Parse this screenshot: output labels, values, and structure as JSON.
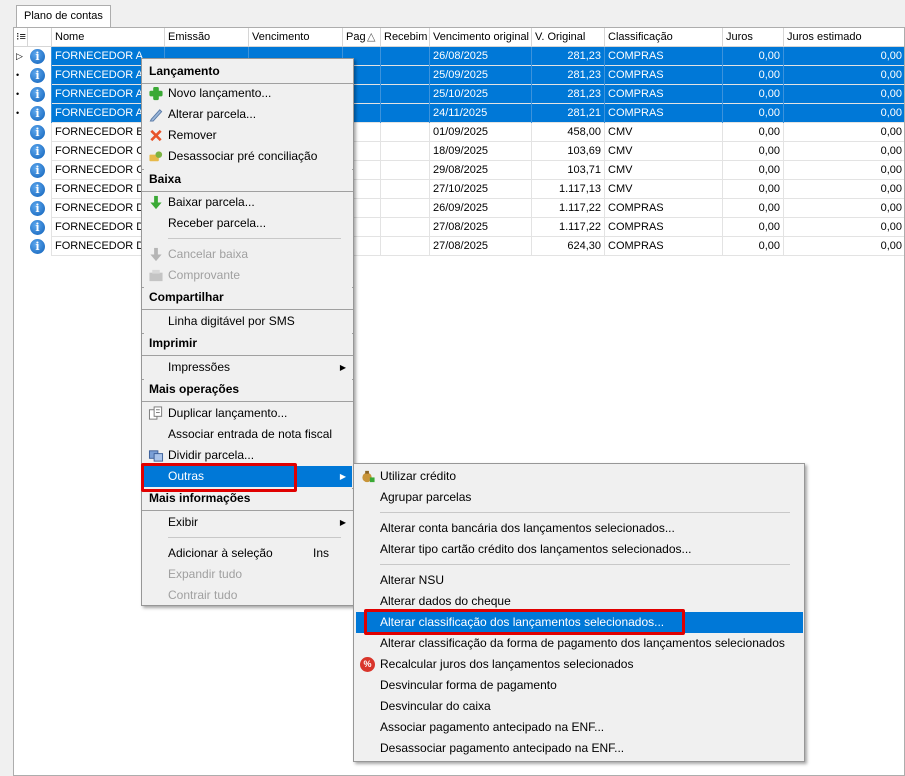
{
  "tab": {
    "label": "Plano de contas"
  },
  "grid": {
    "columns": [
      "Nome",
      "Emissão",
      "Vencimento",
      "Pag",
      "Recebim",
      "Vencimento original",
      "V. Original",
      "Classificação",
      "Juros",
      "Juros estimado"
    ],
    "rows": [
      {
        "nome": "FORNECEDOR A",
        "venc_orig": "26/08/2025",
        "v_original": "281,23",
        "classificacao": "COMPRAS",
        "juros": "0,00",
        "juros_est": "0,00",
        "selected": true
      },
      {
        "nome": "FORNECEDOR A",
        "venc_orig": "25/09/2025",
        "v_original": "281,23",
        "classificacao": "COMPRAS",
        "juros": "0,00",
        "juros_est": "0,00",
        "selected": true
      },
      {
        "nome": "FORNECEDOR A",
        "venc_orig": "25/10/2025",
        "v_original": "281,23",
        "classificacao": "COMPRAS",
        "juros": "0,00",
        "juros_est": "0,00",
        "selected": true
      },
      {
        "nome": "FORNECEDOR A",
        "venc_orig": "24/11/2025",
        "v_original": "281,21",
        "classificacao": "COMPRAS",
        "juros": "0,00",
        "juros_est": "0,00",
        "selected": true
      },
      {
        "nome": "FORNECEDOR B",
        "venc_orig": "01/09/2025",
        "v_original": "458,00",
        "classificacao": "CMV",
        "juros": "0,00",
        "juros_est": "0,00",
        "selected": false
      },
      {
        "nome": "FORNECEDOR C",
        "venc_orig": "18/09/2025",
        "v_original": "103,69",
        "classificacao": "CMV",
        "juros": "0,00",
        "juros_est": "0,00",
        "selected": false
      },
      {
        "nome": "FORNECEDOR C",
        "venc_orig": "29/08/2025",
        "v_original": "103,71",
        "classificacao": "CMV",
        "juros": "0,00",
        "juros_est": "0,00",
        "selected": false
      },
      {
        "nome": "FORNECEDOR D",
        "venc_orig": "27/10/2025",
        "v_original": "1.117,13",
        "classificacao": "CMV",
        "juros": "0,00",
        "juros_est": "0,00",
        "selected": false
      },
      {
        "nome": "FORNECEDOR D",
        "venc_orig": "26/09/2025",
        "v_original": "1.117,22",
        "classificacao": "COMPRAS",
        "juros": "0,00",
        "juros_est": "0,00",
        "selected": false
      },
      {
        "nome": "FORNECEDOR D",
        "venc_orig": "27/08/2025",
        "v_original": "1.117,22",
        "classificacao": "COMPRAS",
        "juros": "0,00",
        "juros_est": "0,00",
        "selected": false
      },
      {
        "nome": "FORNECEDOR D",
        "venc_orig": "27/08/2025",
        "v_original": "624,30",
        "classificacao": "COMPRAS",
        "juros": "0,00",
        "juros_est": "0,00",
        "selected": false
      }
    ]
  },
  "context_menu": {
    "sections": {
      "lancamento": "Lançamento",
      "baixa": "Baixa",
      "compartilhar": "Compartilhar",
      "imprimir": "Imprimir",
      "mais_operacoes": "Mais operações",
      "mais_informacoes": "Mais informações"
    },
    "items": {
      "novo_lancamento": "Novo lançamento...",
      "alterar_parcela": "Alterar parcela...",
      "remover": "Remover",
      "desassociar_pre": "Desassociar pré conciliação",
      "baixar_parcela": "Baixar parcela...",
      "receber_parcela": "Receber parcela...",
      "cancelar_baixa": "Cancelar baixa",
      "comprovante": "Comprovante",
      "linha_digitavel": "Linha digitável por SMS",
      "impressoes": "Impressões",
      "duplicar": "Duplicar lançamento...",
      "associar_nota": "Associar entrada de nota fiscal",
      "dividir_parcela": "Dividir parcela...",
      "outras": "Outras",
      "exibir": "Exibir",
      "adicionar_selecao": "Adicionar à seleção",
      "adicionar_selecao_shortcut": "Ins",
      "expandir_tudo": "Expandir tudo",
      "contrair_tudo": "Contrair tudo"
    }
  },
  "submenu": {
    "items": {
      "utilizar_credito": "Utilizar crédito",
      "agrupar_parcelas": "Agrupar parcelas",
      "alterar_conta": "Alterar conta bancária dos lançamentos selecionados...",
      "alterar_cartao": "Alterar tipo cartão crédito dos lançamentos selecionados...",
      "alterar_nsu": "Alterar NSU",
      "alterar_cheque": "Alterar dados do cheque",
      "alterar_classificacao": "Alterar classificação dos lançamentos selecionados...",
      "alterar_class_forma": "Alterar classificação da forma de pagamento dos lançamentos selecionados",
      "recalcular_juros": "Recalcular juros dos lançamentos selecionados",
      "desvincular_forma": "Desvincular forma de pagamento",
      "desvincular_caixa": "Desvincular do caixa",
      "associar_enf": "Associar pagamento antecipado na ENF...",
      "desassociar_enf": "Desassociar pagamento antecipado na ENF..."
    }
  },
  "colors": {
    "selection": "#0078d7",
    "highlight_box": "#e00000"
  }
}
